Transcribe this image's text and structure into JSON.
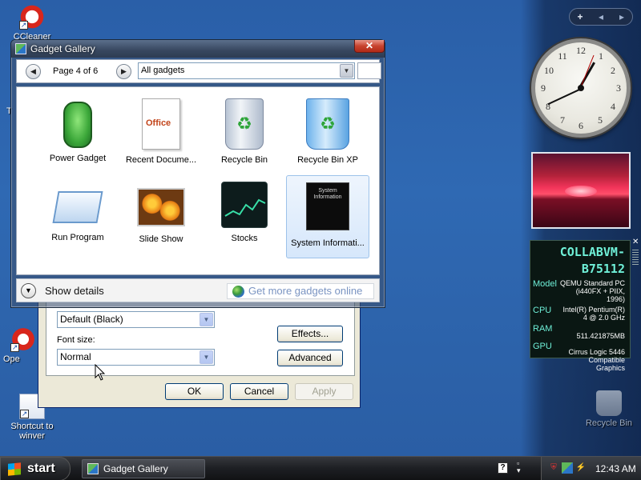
{
  "desktop": {
    "icons": [
      {
        "label": "CCleaner",
        "icon": "ccleaner-icon"
      },
      {
        "label": "Ope",
        "icon": "shortcut-icon"
      },
      {
        "label": "Shortcut to winver",
        "icon": "shortcut-icon"
      },
      {
        "label": "Recycle Bin",
        "icon": "recycle-bin-icon"
      }
    ],
    "partial_letter": "T"
  },
  "sidebar": {
    "controls": {
      "add": "+",
      "prev": "◂",
      "next": "▸"
    },
    "clock": {
      "numbers": [
        "12",
        "1",
        "2",
        "3",
        "4",
        "5",
        "6",
        "7",
        "8",
        "9",
        "10",
        "11"
      ]
    },
    "sysinfo": {
      "hostname_1": "COLLABVM-",
      "hostname_2": "B75112",
      "model_label": "Model",
      "model_value": "QEMU Standard PC (i440FX + PIIX, 1996)",
      "cpu_label": "CPU",
      "cpu_value": "Intel(R) Pentium(R) 4 @ 2.0 GHz",
      "ram_label": "RAM",
      "ram_value": "511.421875MB",
      "gpu_label": "GPU",
      "gpu_value": "Cirrus Logic 5446 Compatible Graphics",
      "close": "✕"
    }
  },
  "back_dialog": {
    "scheme_value": "Default (Black)",
    "font_size_label": "Font size:",
    "font_size_value": "Normal",
    "effects_label": "Effects...",
    "advanced_label": "Advanced",
    "ok_label": "OK",
    "cancel_label": "Cancel",
    "apply_label": "Apply"
  },
  "gallery": {
    "title": "Gadget Gallery",
    "close": "✕",
    "page_label": "Page 4 of 6",
    "category_value": "All gadgets",
    "gadgets": [
      {
        "name": "Power Gadget",
        "icon": "battery-icon"
      },
      {
        "name": "Recent Docume...",
        "icon": "office-doc-icon",
        "badge": "Office"
      },
      {
        "name": "Recycle Bin",
        "icon": "recycle-bin-icon"
      },
      {
        "name": "Recycle Bin XP",
        "icon": "recycle-bin-xp-icon"
      },
      {
        "name": "Run Program",
        "icon": "run-program-icon"
      },
      {
        "name": "Slide Show",
        "icon": "slideshow-icon"
      },
      {
        "name": "Stocks",
        "icon": "stocks-icon"
      },
      {
        "name": "System Informati...",
        "icon": "system-info-icon",
        "thumb_text": "System Information"
      }
    ],
    "show_details": "Show details",
    "get_more": "Get more gadgets online"
  },
  "taskbar": {
    "start_label": "start",
    "task_label": "Gadget Gallery",
    "time": "12:43 AM"
  }
}
